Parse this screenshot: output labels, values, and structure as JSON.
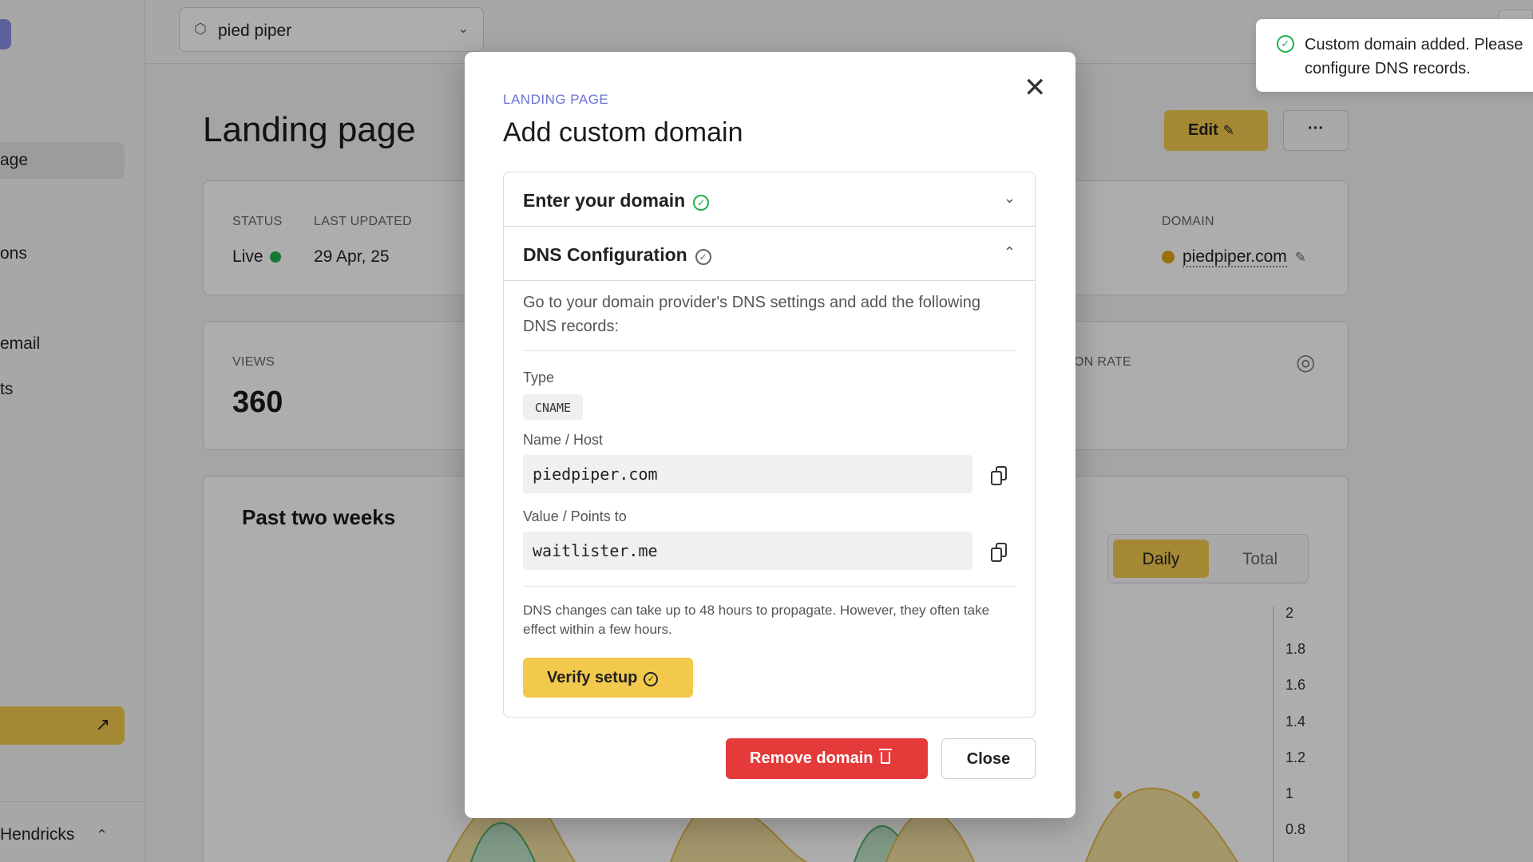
{
  "sidebar": {
    "items": [
      {
        "label": "age"
      },
      {
        "label": "ons"
      },
      {
        "label": "email"
      },
      {
        "label": "ts"
      }
    ],
    "cta_icon": "arrow-up-right-icon",
    "user_name": "Hendricks"
  },
  "topbar": {
    "project_name": "pied piper"
  },
  "page": {
    "title": "Landing page",
    "edit_label": "Edit",
    "more_label": "···"
  },
  "status_card": {
    "status_label": "STATUS",
    "status_value": "Live",
    "updated_label": "LAST UPDATED",
    "updated_value": "29 Apr, 25",
    "domain_label": "DOMAIN",
    "domain_value": "piedpiper.com"
  },
  "views_card": {
    "views_label": "VIEWS",
    "views_value": "360",
    "conversion_label": "ON RATE"
  },
  "chart_card": {
    "title": "Past two weeks",
    "toggle_daily": "Daily",
    "toggle_total": "Total",
    "y_ticks": [
      "2",
      "1.8",
      "1.6",
      "1.4",
      "1.2",
      "1",
      "0.8"
    ]
  },
  "toast": {
    "message": "Custom domain added. Please configure DNS records."
  },
  "modal": {
    "eyebrow": "LANDING PAGE",
    "title": "Add custom domain",
    "step1_title": "Enter your domain",
    "step2_title": "DNS Configuration",
    "intro": "Go to your domain provider's DNS settings and add the following DNS records:",
    "type_label": "Type",
    "type_value": "CNAME",
    "name_label": "Name / Host",
    "name_value": "piedpiper.com",
    "value_label": "Value / Points to",
    "value_value": "waitlister.me",
    "note": "DNS changes can take up to 48 hours to propagate. However, they often take effect within a few hours.",
    "verify_label": "Verify setup",
    "remove_label": "Remove domain",
    "close_label": "Close"
  },
  "colors": {
    "accent_yellow": "#f2c94c",
    "danger_red": "#e53a3a",
    "success_green": "#22b14c",
    "eyebrow_purple": "#6b72d6"
  }
}
